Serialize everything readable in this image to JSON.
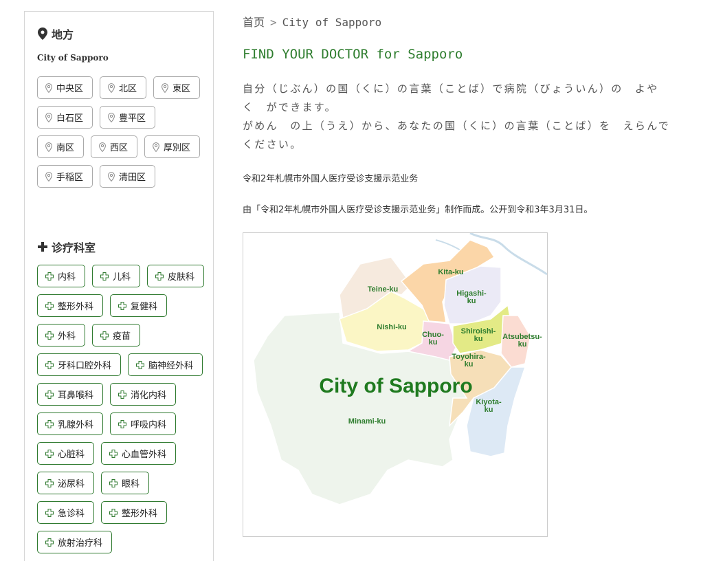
{
  "sidebar": {
    "area_heading": "地方",
    "city_label": "City of Sapporo",
    "areas": [
      "中央区",
      "北区",
      "東区",
      "白石区",
      "豊平区",
      "南区",
      "西区",
      "厚別区",
      "手稲区",
      "清田区"
    ],
    "dept_heading": "诊疗科室",
    "departments": [
      "内科",
      "儿科",
      "皮肤科",
      "整形外科",
      "复健科",
      "外科",
      "疫苗",
      "牙科口腔外科",
      "脑神经外科",
      "耳鼻喉科",
      "消化内科",
      "乳腺外科",
      "呼吸内科",
      "心脏科",
      "心血管外科",
      "泌尿科",
      "眼科",
      "急诊科",
      "整形外科",
      "放射治疗科"
    ]
  },
  "breadcrumb": {
    "home": "首页",
    "current": "City of Sapporo"
  },
  "page_title": "FIND YOUR DOCTOR for Sapporo",
  "intro_lines": [
    "自分（じぶん）の国（くに）の言葉（ことば）で病院（びょういん）の　よや",
    "く　ができます。",
    "がめん　の上（うえ）から、あなたの国（くに）の言葉（ことば）を　えらんで",
    "ください。"
  ],
  "program_name": "令和2年札幌市外国人医疗受诊支援示范业务",
  "program_note": "由「令和2年札幌市外国人医疗受诊支援示范业务」制作而成。公开到令和3年3月31日。",
  "map": {
    "title": "City of Sapporo",
    "wards": {
      "kita": "Kita-ku",
      "teine": "Teine-ku",
      "higashi1": "Higashi-",
      "higashi2": "ku",
      "nishi": "Nishi-ku",
      "chuo1": "Chuo-",
      "chuo2": "ku",
      "shiroishi1": "Shiroishi-",
      "shiroishi2": "ku",
      "atsubetsu1": "Atsubetsu-",
      "atsubetsu2": "ku",
      "toyohira1": "Toyohira-",
      "toyohira2": "ku",
      "kiyota1": "Kiyota-",
      "kiyota2": "ku",
      "minami": "Minami-ku"
    }
  },
  "colors": {
    "accent": "#2e7d2e",
    "chip_border_dept": "#2f7a2f",
    "chip_border_area": "#aaaaaa"
  }
}
